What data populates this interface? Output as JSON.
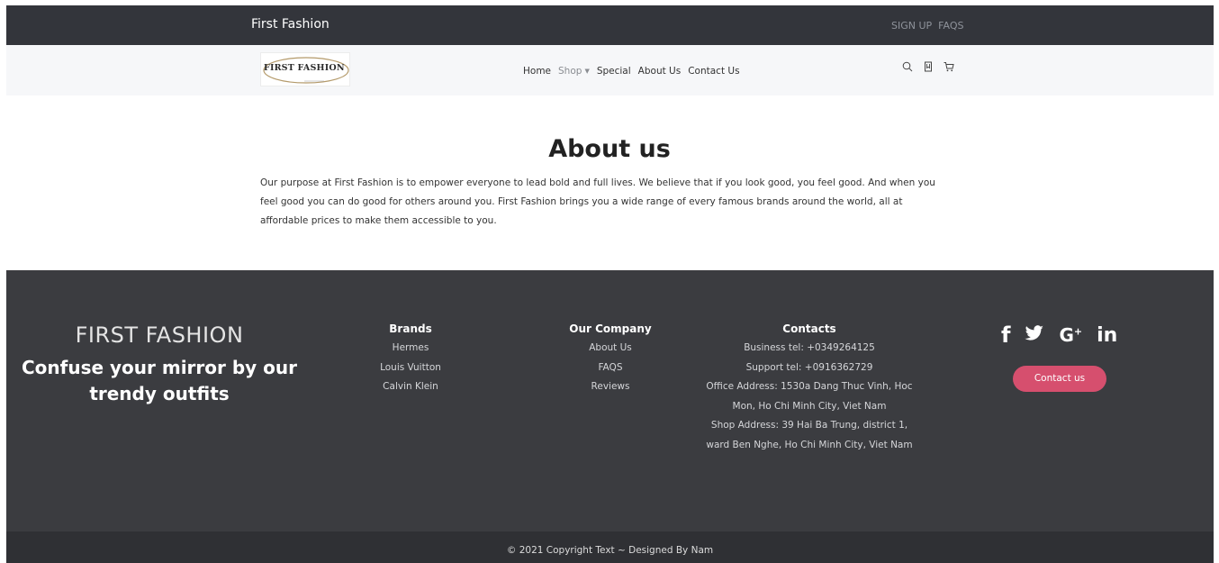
{
  "topbar": {
    "brand": "First Fashion",
    "links": [
      "SIGN UP",
      "FAQS"
    ]
  },
  "navbar": {
    "logo_text": "FIRST FASHION",
    "menu": {
      "home": "Home",
      "shop": "Shop",
      "special": "Special",
      "about": "About Us",
      "contact": "Contact Us"
    },
    "icons": [
      "search-icon",
      "bookmark-icon",
      "cart-icon"
    ]
  },
  "about": {
    "title": "About us",
    "text": "Our purpose at First Fashion is to empower everyone to lead bold and full lives. We believe that if you look good, you feel good. And when you feel good you can do good for others around you. First Fashion brings you a wide range of every famous brands around the world, all at affordable prices to make them accessible to you."
  },
  "footer": {
    "brand_name": "FIRST FASHION",
    "slogan": "Confuse your mirror by our trendy outfits",
    "brands": {
      "heading": "Brands",
      "items": [
        "Hermes",
        "Louis Vuitton",
        "Calvin Klein"
      ]
    },
    "company": {
      "heading": "Our Company",
      "items": [
        "About Us",
        "FAQS",
        "Reviews"
      ]
    },
    "contacts": {
      "heading": "Contacts",
      "business": "Business tel: +0349264125",
      "support": "Support tel: +0916362729",
      "office": "Office Address: 1530a Dang Thuc Vinh, Hoc Mon, Ho Chi Minh City, Viet Nam",
      "shop": "Shop Address: 39 Hai Ba Trung, district 1, ward Ben Nghe, Ho Chi Minh City, Viet Nam"
    },
    "social": {
      "facebook": "f",
      "twitter": "🐦",
      "google": "G+",
      "linkedin": "in"
    },
    "contact_button": "Contact us",
    "copyright": "© 2021 Copyright Text ~ Designed By Nam"
  },
  "colors": {
    "topbar": "#33353b",
    "navbar": "#f6f7f9",
    "footer": "#3b3c40",
    "copybar": "#2f3034",
    "accent": "#d64f6e"
  }
}
